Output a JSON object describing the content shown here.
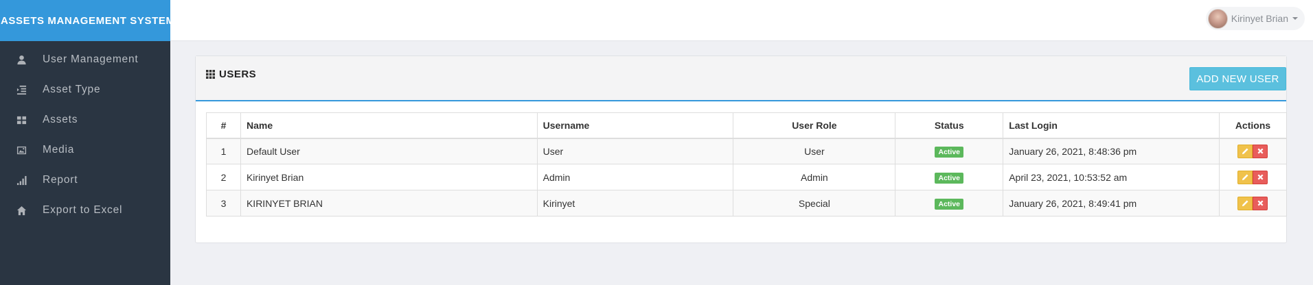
{
  "app": {
    "title": "ASSETS MANAGEMENT SYSTEM"
  },
  "sidebar": {
    "items": [
      {
        "label": "User Management",
        "icon": "user-icon"
      },
      {
        "label": "Asset Type",
        "icon": "indent-icon"
      },
      {
        "label": "Assets",
        "icon": "grid-icon"
      },
      {
        "label": "Media",
        "icon": "image-icon"
      },
      {
        "label": "Report",
        "icon": "signal-icon"
      },
      {
        "label": "Export to Excel",
        "icon": "home-icon"
      }
    ]
  },
  "header": {
    "user_name": "Kirinyet Brian"
  },
  "panel": {
    "title": "USERS",
    "add_button": "ADD NEW USER"
  },
  "table": {
    "columns": [
      "#",
      "Name",
      "Username",
      "User Role",
      "Status",
      "Last Login",
      "Actions"
    ],
    "rows": [
      {
        "num": "1",
        "name": "Default User",
        "username": "User",
        "role": "User",
        "status": "Active",
        "last_login": "January 26, 2021, 8:48:36 pm"
      },
      {
        "num": "2",
        "name": "Kirinyet Brian",
        "username": "Admin",
        "role": "Admin",
        "status": "Active",
        "last_login": "April 23, 2021, 10:53:52 am"
      },
      {
        "num": "3",
        "name": "KIRINYET BRIAN",
        "username": "Kirinyet",
        "role": "Special",
        "status": "Active",
        "last_login": "January 26, 2021, 8:49:41 pm"
      }
    ]
  },
  "colors": {
    "sidebar_bg": "#2a3542",
    "brand_bg": "#3498db",
    "accent": "#5bc0de",
    "status_active": "#5cb85c",
    "edit": "#f0c24b",
    "delete": "#e85d5b"
  }
}
